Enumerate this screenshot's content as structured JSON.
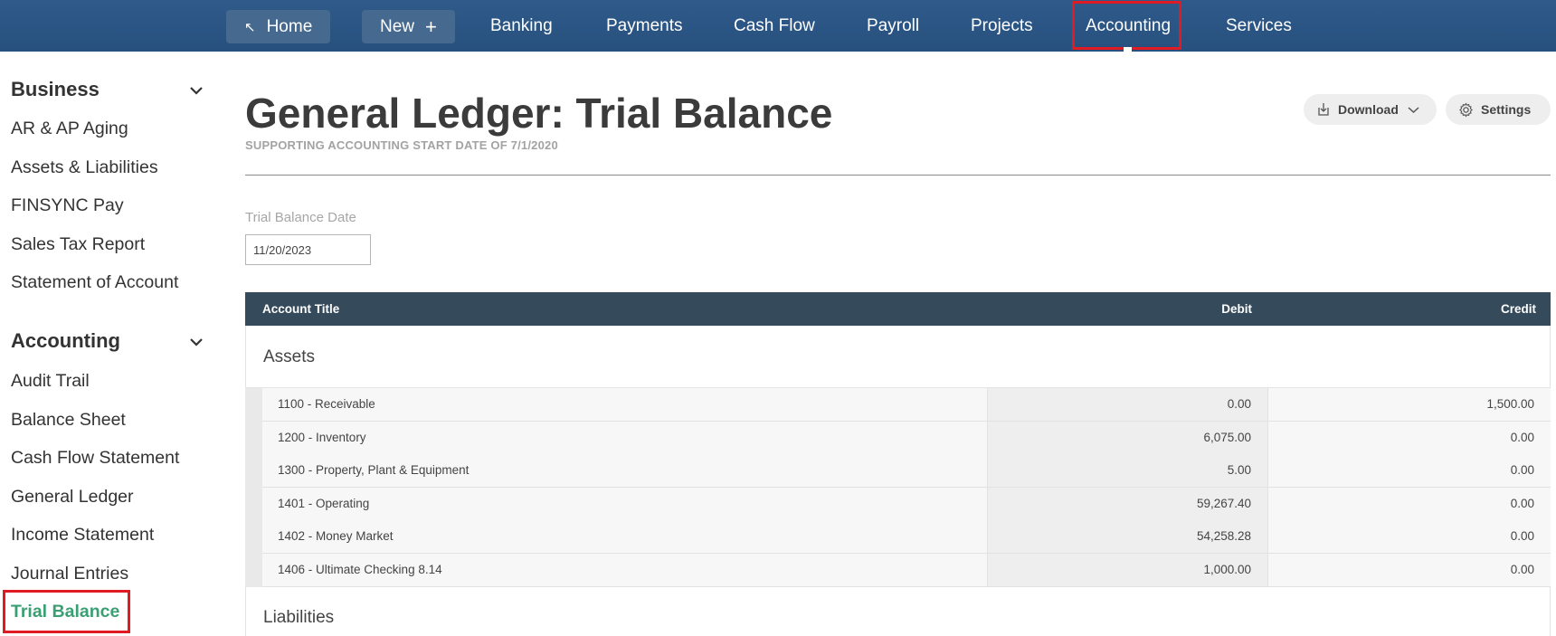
{
  "nav": {
    "home": "Home",
    "new": "New",
    "banking": "Banking",
    "payments": "Payments",
    "cash_flow": "Cash Flow",
    "payroll": "Payroll",
    "projects": "Projects",
    "accounting": "Accounting",
    "services": "Services"
  },
  "sidebar": {
    "business": {
      "heading": "Business",
      "items": [
        "AR & AP Aging",
        "Assets & Liabilities",
        "FINSYNC Pay",
        "Sales Tax Report",
        "Statement of Account"
      ]
    },
    "accounting": {
      "heading": "Accounting",
      "items": [
        "Audit Trail",
        "Balance Sheet",
        "Cash Flow Statement",
        "General Ledger",
        "Income Statement",
        "Journal Entries",
        "Trial Balance"
      ]
    },
    "active_item": "Trial Balance"
  },
  "page": {
    "title": "General Ledger: Trial Balance",
    "subtitle": "SUPPORTING ACCOUNTING START DATE OF 7/1/2020",
    "download_label": "Download",
    "settings_label": "Settings",
    "date_label": "Trial Balance Date",
    "date_value": "11/20/2023"
  },
  "table": {
    "headers": {
      "account": "Account Title",
      "debit": "Debit",
      "credit": "Credit"
    },
    "sections": [
      {
        "name": "Assets",
        "rows": [
          {
            "account": "1100 - Receivable",
            "debit": "0.00",
            "credit": "1,500.00"
          },
          {
            "account": "1200 - Inventory",
            "debit": "6,075.00",
            "credit": "0.00"
          },
          {
            "account": "1300 - Property, Plant & Equipment",
            "debit": "5.00",
            "credit": "0.00"
          },
          {
            "account": "1401 - Operating",
            "debit": "59,267.40",
            "credit": "0.00"
          },
          {
            "account": "1402 - Money Market",
            "debit": "54,258.28",
            "credit": "0.00"
          },
          {
            "account": "1406 - Ultimate Checking 8.14",
            "debit": "1,000.00",
            "credit": "0.00"
          }
        ]
      },
      {
        "name": "Liabilities",
        "rows": []
      }
    ]
  },
  "colors": {
    "nav_bg": "#2b5585",
    "table_header_bg": "#354a5b",
    "active_link": "#3a9f73",
    "highlight_outline": "#e11b23"
  }
}
